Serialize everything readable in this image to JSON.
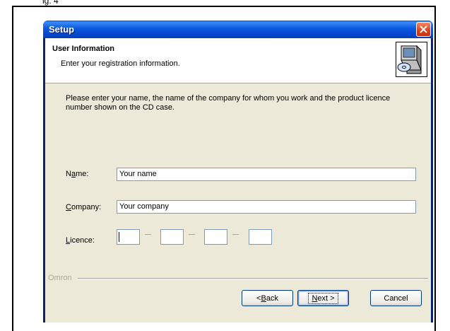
{
  "caption": "ig. 4",
  "window": {
    "title": "Setup"
  },
  "header": {
    "title": "User Information",
    "subtitle": "Enter your registration information."
  },
  "intro_text": "Please enter your name, the name of the company for whom you work and the product licence number shown on the CD case.",
  "form": {
    "name_label_prefix": "N",
    "name_label_mnemonic": "a",
    "name_label_suffix": "me:",
    "name_value": "Your name",
    "company_label_mnemonic": "C",
    "company_label_suffix": "ompany:",
    "company_value": "Your company",
    "licence_label_mnemonic": "L",
    "licence_label_suffix": "icence:",
    "licence_values": [
      "",
      "",
      "",
      ""
    ]
  },
  "footer": {
    "group_label": "Omron",
    "back_pre": "< ",
    "back_mnemonic": "B",
    "back_suffix": "ack",
    "next_mnemonic": "N",
    "next_suffix": "ext >",
    "cancel_label": "Cancel"
  },
  "icons": {
    "close": "close-icon",
    "header": "computer-cd-icon"
  }
}
